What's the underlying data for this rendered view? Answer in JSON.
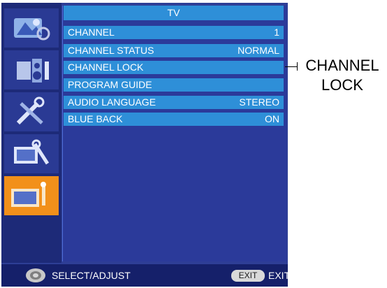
{
  "menu": {
    "title": "TV",
    "rows": [
      {
        "label": "CHANNEL",
        "value": "1"
      },
      {
        "label": "CHANNEL STATUS",
        "value": "NORMAL"
      },
      {
        "label": "CHANNEL LOCK",
        "value": ""
      },
      {
        "label": "PROGRAM GUIDE",
        "value": ""
      },
      {
        "label": "AUDIO LANGUAGE",
        "value": "STEREO"
      },
      {
        "label": "BLUE BACK",
        "value": "ON"
      }
    ]
  },
  "sidebar": {
    "icons": [
      {
        "name": "picture-icon"
      },
      {
        "name": "sound-icon"
      },
      {
        "name": "setup-tools-icon"
      },
      {
        "name": "tv-settings-icon"
      },
      {
        "name": "tv-menu-icon",
        "active": true
      }
    ]
  },
  "footer": {
    "select_label": "SELECT/ADJUST",
    "exit_key_label": "EXIT",
    "exit_label": "EXIT"
  },
  "callout": {
    "line1": "CHANNEL",
    "line2": "LOCK"
  },
  "colors": {
    "background": "#2e3e96",
    "menu_row": "#2e8fd8",
    "active_tile": "#f2901a",
    "footer": "#15206a"
  }
}
